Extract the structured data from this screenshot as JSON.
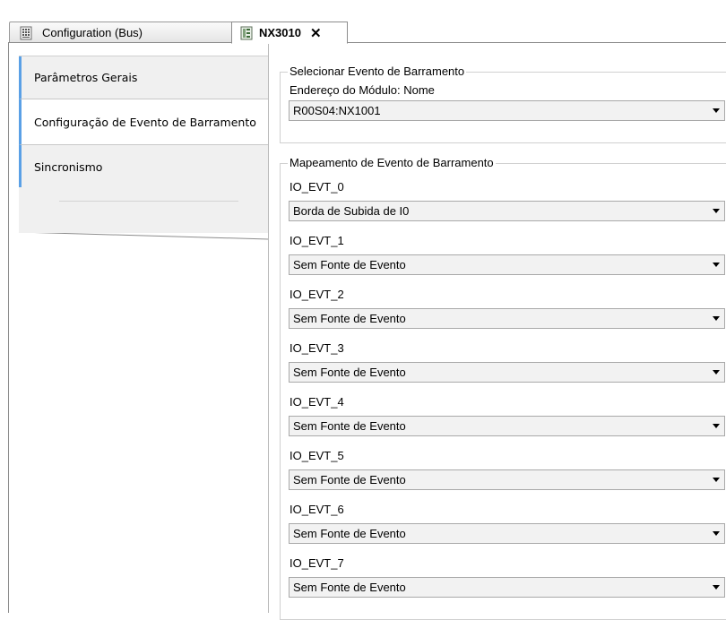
{
  "tabs": [
    {
      "label": "Configuration (Bus)",
      "icon": "grid-config-icon"
    },
    {
      "label": "NX3010",
      "icon": "device-module-icon",
      "close": "✕"
    }
  ],
  "nav": {
    "items": [
      {
        "label": "Parâmetros Gerais"
      },
      {
        "label": "Configuração de Evento de Barramento",
        "selected": true
      },
      {
        "label": "Sincronismo"
      }
    ]
  },
  "select_event": {
    "legend": "Selecionar Evento de Barramento",
    "module_label": "Endereço do Módulo: Nome",
    "module_value": "R00S04:NX1001"
  },
  "mapping": {
    "legend": "Mapeamento de Evento de Barramento",
    "events": [
      {
        "label": "IO_EVT_0",
        "value": "Borda de Subida de I0"
      },
      {
        "label": "IO_EVT_1",
        "value": "Sem Fonte de Evento"
      },
      {
        "label": "IO_EVT_2",
        "value": "Sem Fonte de Evento"
      },
      {
        "label": "IO_EVT_3",
        "value": "Sem Fonte de Evento"
      },
      {
        "label": "IO_EVT_4",
        "value": "Sem Fonte de Evento"
      },
      {
        "label": "IO_EVT_5",
        "value": "Sem Fonte de Evento"
      },
      {
        "label": "IO_EVT_6",
        "value": "Sem Fonte de Evento"
      },
      {
        "label": "IO_EVT_7",
        "value": "Sem Fonte de Evento"
      }
    ]
  },
  "colors": {
    "nav_accent": "#5aa0e6",
    "nav_background": "#f0f0f0",
    "combo_background": "#f2f2f2"
  }
}
